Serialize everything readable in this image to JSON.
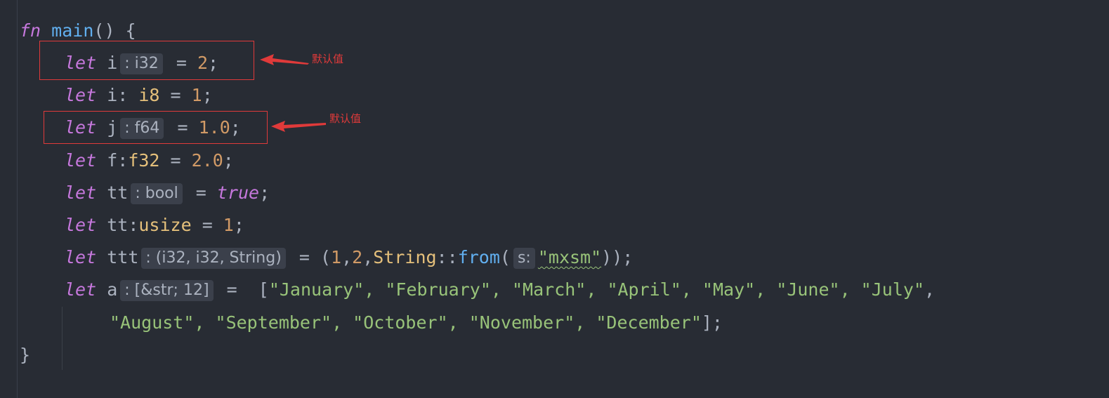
{
  "code": {
    "l1": {
      "kw": "fn",
      "name": "main",
      "rest": "() {"
    },
    "l2": {
      "kw": "let",
      "var": "i",
      "hint": ": i32",
      "eq": " = ",
      "val": "2",
      "end": ";"
    },
    "l3": {
      "kw": "let",
      "var": "i: ",
      "type": "i8",
      "eq": " = ",
      "val": "1",
      "end": ";"
    },
    "l4": {
      "kw": "let",
      "var": "j",
      "hint": ": f64",
      "eq": " = ",
      "val": "1.0",
      "end": ";"
    },
    "l5": {
      "kw": "let",
      "var": "f:",
      "type": "f32",
      "eq": " = ",
      "val": "2.0",
      "end": ";"
    },
    "l6": {
      "kw": "let",
      "var": "tt",
      "hint": ": bool",
      "eq": " = ",
      "val": "true",
      "end": ";"
    },
    "l7": {
      "kw": "let",
      "var": "tt:",
      "type": "usize",
      "eq": " = ",
      "val": "1",
      "end": ";"
    },
    "l8": {
      "kw": "let",
      "var": "ttt",
      "hint": ": (i32, i32, String)",
      "eq": " = (",
      "n1": "1",
      "c1": ",",
      "n2": "2",
      "c2": ",",
      "type": "String",
      "sep": "::",
      "fn": "from",
      "open": "(",
      "param_hint": "s:",
      "str": "\"mxsm\"",
      "end": "));"
    },
    "l9": {
      "kw": "let",
      "var": "a",
      "hint": ": [&str; 12]",
      "eq": " =  [",
      "items": "\"January\", \"February\", \"March\", \"April\", \"May\", \"June\", \"July\"",
      "end": ","
    },
    "l10": {
      "items": "\"August\", \"September\", \"October\", \"November\", \"December\"",
      "end": "];"
    },
    "l11": {
      "brace": "}"
    }
  },
  "annotations": [
    {
      "label": "默认值"
    },
    {
      "label": "默认值"
    }
  ],
  "colors": {
    "annotation": "#e03a3a",
    "keyword": "#c678dd",
    "function": "#61afef",
    "type": "#e5c07b",
    "number": "#d19a66",
    "string": "#98c379"
  }
}
